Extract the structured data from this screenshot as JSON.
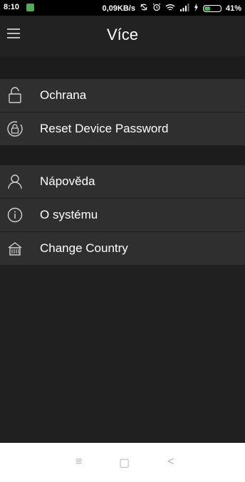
{
  "status": {
    "time": "8:10",
    "network_speed": "0,09KB/s",
    "battery": "41%",
    "battery_level": 0.41,
    "icons": [
      "notification-icon",
      "sync-off-icon",
      "alarm-icon",
      "wifi-icon",
      "signal-icon",
      "charging-icon"
    ]
  },
  "header": {
    "title": "Více",
    "menu_icon": "hamburger-menu-icon"
  },
  "section1": [
    {
      "label": "Ochrana",
      "icon": "lock-icon"
    },
    {
      "label": "Reset Device Password",
      "icon": "lock-reset-icon"
    }
  ],
  "section2": [
    {
      "label": "Nápověda",
      "icon": "user-icon"
    },
    {
      "label": "O systému",
      "icon": "info-icon"
    },
    {
      "label": "Change Country",
      "icon": "building-icon"
    }
  ],
  "nav": {
    "menu": "≡",
    "home": "▢",
    "back": "<"
  },
  "colors": {
    "background": "#202020",
    "item": "#2f2f2f",
    "accent": "#4caf50"
  }
}
